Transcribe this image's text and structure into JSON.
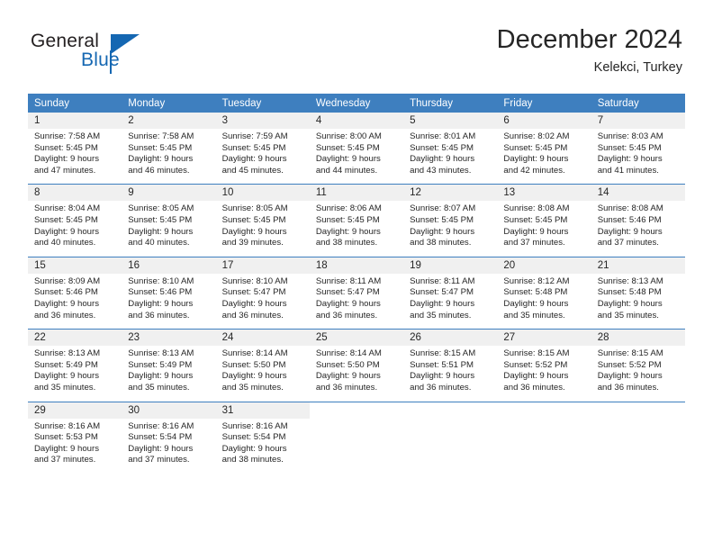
{
  "brand": {
    "name_part1": "General",
    "name_part2": "Blue"
  },
  "header": {
    "title": "December 2024",
    "subtitle": "Kelekci, Turkey"
  },
  "colors": {
    "header_blue": "#3e7fbf",
    "brand_blue": "#1567b2",
    "daynum_bg": "#f0f0f0",
    "text": "#262626"
  },
  "calendar": {
    "weekdays": [
      "Sunday",
      "Monday",
      "Tuesday",
      "Wednesday",
      "Thursday",
      "Friday",
      "Saturday"
    ],
    "weeks": [
      [
        {
          "day": "1",
          "sunrise": "Sunrise: 7:58 AM",
          "sunset": "Sunset: 5:45 PM",
          "daylight1": "Daylight: 9 hours",
          "daylight2": "and 47 minutes."
        },
        {
          "day": "2",
          "sunrise": "Sunrise: 7:58 AM",
          "sunset": "Sunset: 5:45 PM",
          "daylight1": "Daylight: 9 hours",
          "daylight2": "and 46 minutes."
        },
        {
          "day": "3",
          "sunrise": "Sunrise: 7:59 AM",
          "sunset": "Sunset: 5:45 PM",
          "daylight1": "Daylight: 9 hours",
          "daylight2": "and 45 minutes."
        },
        {
          "day": "4",
          "sunrise": "Sunrise: 8:00 AM",
          "sunset": "Sunset: 5:45 PM",
          "daylight1": "Daylight: 9 hours",
          "daylight2": "and 44 minutes."
        },
        {
          "day": "5",
          "sunrise": "Sunrise: 8:01 AM",
          "sunset": "Sunset: 5:45 PM",
          "daylight1": "Daylight: 9 hours",
          "daylight2": "and 43 minutes."
        },
        {
          "day": "6",
          "sunrise": "Sunrise: 8:02 AM",
          "sunset": "Sunset: 5:45 PM",
          "daylight1": "Daylight: 9 hours",
          "daylight2": "and 42 minutes."
        },
        {
          "day": "7",
          "sunrise": "Sunrise: 8:03 AM",
          "sunset": "Sunset: 5:45 PM",
          "daylight1": "Daylight: 9 hours",
          "daylight2": "and 41 minutes."
        }
      ],
      [
        {
          "day": "8",
          "sunrise": "Sunrise: 8:04 AM",
          "sunset": "Sunset: 5:45 PM",
          "daylight1": "Daylight: 9 hours",
          "daylight2": "and 40 minutes."
        },
        {
          "day": "9",
          "sunrise": "Sunrise: 8:05 AM",
          "sunset": "Sunset: 5:45 PM",
          "daylight1": "Daylight: 9 hours",
          "daylight2": "and 40 minutes."
        },
        {
          "day": "10",
          "sunrise": "Sunrise: 8:05 AM",
          "sunset": "Sunset: 5:45 PM",
          "daylight1": "Daylight: 9 hours",
          "daylight2": "and 39 minutes."
        },
        {
          "day": "11",
          "sunrise": "Sunrise: 8:06 AM",
          "sunset": "Sunset: 5:45 PM",
          "daylight1": "Daylight: 9 hours",
          "daylight2": "and 38 minutes."
        },
        {
          "day": "12",
          "sunrise": "Sunrise: 8:07 AM",
          "sunset": "Sunset: 5:45 PM",
          "daylight1": "Daylight: 9 hours",
          "daylight2": "and 38 minutes."
        },
        {
          "day": "13",
          "sunrise": "Sunrise: 8:08 AM",
          "sunset": "Sunset: 5:45 PM",
          "daylight1": "Daylight: 9 hours",
          "daylight2": "and 37 minutes."
        },
        {
          "day": "14",
          "sunrise": "Sunrise: 8:08 AM",
          "sunset": "Sunset: 5:46 PM",
          "daylight1": "Daylight: 9 hours",
          "daylight2": "and 37 minutes."
        }
      ],
      [
        {
          "day": "15",
          "sunrise": "Sunrise: 8:09 AM",
          "sunset": "Sunset: 5:46 PM",
          "daylight1": "Daylight: 9 hours",
          "daylight2": "and 36 minutes."
        },
        {
          "day": "16",
          "sunrise": "Sunrise: 8:10 AM",
          "sunset": "Sunset: 5:46 PM",
          "daylight1": "Daylight: 9 hours",
          "daylight2": "and 36 minutes."
        },
        {
          "day": "17",
          "sunrise": "Sunrise: 8:10 AM",
          "sunset": "Sunset: 5:47 PM",
          "daylight1": "Daylight: 9 hours",
          "daylight2": "and 36 minutes."
        },
        {
          "day": "18",
          "sunrise": "Sunrise: 8:11 AM",
          "sunset": "Sunset: 5:47 PM",
          "daylight1": "Daylight: 9 hours",
          "daylight2": "and 36 minutes."
        },
        {
          "day": "19",
          "sunrise": "Sunrise: 8:11 AM",
          "sunset": "Sunset: 5:47 PM",
          "daylight1": "Daylight: 9 hours",
          "daylight2": "and 35 minutes."
        },
        {
          "day": "20",
          "sunrise": "Sunrise: 8:12 AM",
          "sunset": "Sunset: 5:48 PM",
          "daylight1": "Daylight: 9 hours",
          "daylight2": "and 35 minutes."
        },
        {
          "day": "21",
          "sunrise": "Sunrise: 8:13 AM",
          "sunset": "Sunset: 5:48 PM",
          "daylight1": "Daylight: 9 hours",
          "daylight2": "and 35 minutes."
        }
      ],
      [
        {
          "day": "22",
          "sunrise": "Sunrise: 8:13 AM",
          "sunset": "Sunset: 5:49 PM",
          "daylight1": "Daylight: 9 hours",
          "daylight2": "and 35 minutes."
        },
        {
          "day": "23",
          "sunrise": "Sunrise: 8:13 AM",
          "sunset": "Sunset: 5:49 PM",
          "daylight1": "Daylight: 9 hours",
          "daylight2": "and 35 minutes."
        },
        {
          "day": "24",
          "sunrise": "Sunrise: 8:14 AM",
          "sunset": "Sunset: 5:50 PM",
          "daylight1": "Daylight: 9 hours",
          "daylight2": "and 35 minutes."
        },
        {
          "day": "25",
          "sunrise": "Sunrise: 8:14 AM",
          "sunset": "Sunset: 5:50 PM",
          "daylight1": "Daylight: 9 hours",
          "daylight2": "and 36 minutes."
        },
        {
          "day": "26",
          "sunrise": "Sunrise: 8:15 AM",
          "sunset": "Sunset: 5:51 PM",
          "daylight1": "Daylight: 9 hours",
          "daylight2": "and 36 minutes."
        },
        {
          "day": "27",
          "sunrise": "Sunrise: 8:15 AM",
          "sunset": "Sunset: 5:52 PM",
          "daylight1": "Daylight: 9 hours",
          "daylight2": "and 36 minutes."
        },
        {
          "day": "28",
          "sunrise": "Sunrise: 8:15 AM",
          "sunset": "Sunset: 5:52 PM",
          "daylight1": "Daylight: 9 hours",
          "daylight2": "and 36 minutes."
        }
      ],
      [
        {
          "day": "29",
          "sunrise": "Sunrise: 8:16 AM",
          "sunset": "Sunset: 5:53 PM",
          "daylight1": "Daylight: 9 hours",
          "daylight2": "and 37 minutes."
        },
        {
          "day": "30",
          "sunrise": "Sunrise: 8:16 AM",
          "sunset": "Sunset: 5:54 PM",
          "daylight1": "Daylight: 9 hours",
          "daylight2": "and 37 minutes."
        },
        {
          "day": "31",
          "sunrise": "Sunrise: 8:16 AM",
          "sunset": "Sunset: 5:54 PM",
          "daylight1": "Daylight: 9 hours",
          "daylight2": "and 38 minutes."
        },
        {
          "day": "",
          "sunrise": "",
          "sunset": "",
          "daylight1": "",
          "daylight2": ""
        },
        {
          "day": "",
          "sunrise": "",
          "sunset": "",
          "daylight1": "",
          "daylight2": ""
        },
        {
          "day": "",
          "sunrise": "",
          "sunset": "",
          "daylight1": "",
          "daylight2": ""
        },
        {
          "day": "",
          "sunrise": "",
          "sunset": "",
          "daylight1": "",
          "daylight2": ""
        }
      ]
    ]
  }
}
